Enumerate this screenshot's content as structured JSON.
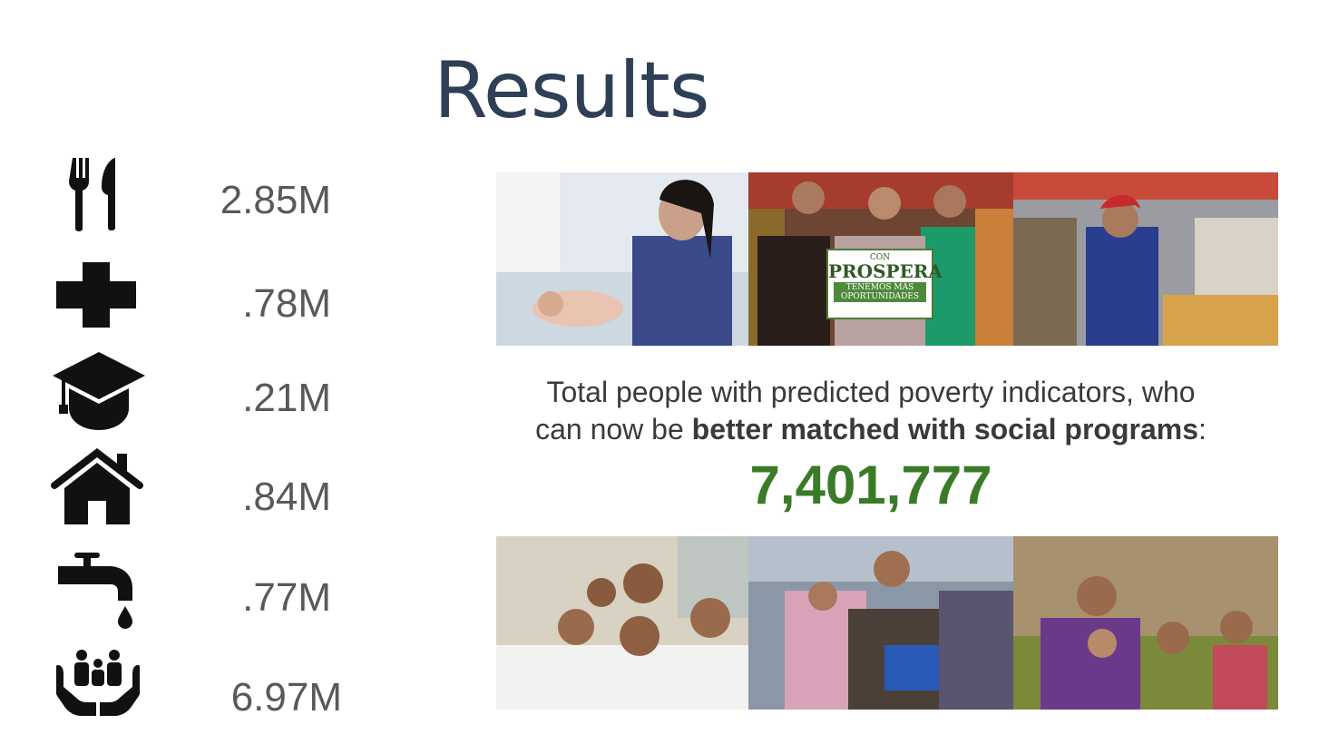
{
  "title": "Results",
  "indicators": [
    {
      "icon": "fork-knife-icon",
      "value": "2.85M"
    },
    {
      "icon": "medical-cross-icon",
      "value": ".78M"
    },
    {
      "icon": "graduation-cap-icon",
      "value": ".21M"
    },
    {
      "icon": "house-icon",
      "value": ".84M"
    },
    {
      "icon": "water-tap-icon",
      "value": ".77M"
    },
    {
      "icon": "family-in-hands-icon",
      "value": "6.97M"
    }
  ],
  "caption": {
    "line1": "Total people with predicted poverty indicators, who",
    "prefix": "can now be ",
    "emphasis": "better matched with social programs",
    "suffix": ":"
  },
  "total": "7,401,777",
  "sign": {
    "top": "CON",
    "brand": "PROSPERA",
    "slogan": "TENEMOS MÁS OPORTUNIDADES"
  },
  "colors": {
    "title": "#2e3f56",
    "stat": "#595959",
    "total": "#3a7b27",
    "icon": "#111111"
  }
}
